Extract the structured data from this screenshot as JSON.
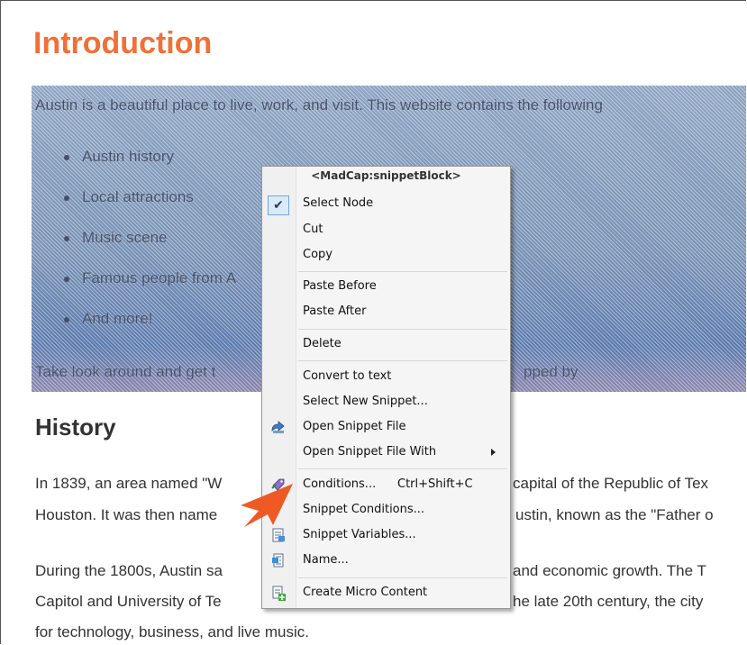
{
  "page": {
    "heading": "Introduction",
    "selected_block": {
      "intro": "Austin is a beautiful place to live, work, and visit. This website contains the following",
      "bullets": [
        "Austin history",
        "Local attractions",
        "Music scene",
        "Famous people from A",
        "And more!"
      ],
      "closing_left": "Take look around and get t",
      "closing_right": "pped by"
    },
    "history_heading": "History",
    "paragraph1": {
      "line1_left": "In 1839, an area named \"W",
      "line1_right": "capital of the Republic of Tex",
      "line2_left": "Houston. It was then name",
      "line2_right": "ustin, known as the \"Father o"
    },
    "paragraph2": {
      "line1_left": "During the 1800s, Austin sa",
      "line1_right": "and economic growth. The T",
      "line2_left": "Capitol and University of Te",
      "line2_right": "he late 20th century, the city",
      "line3": "for technology, business, and live music."
    }
  },
  "context_menu": {
    "header": "<MadCap:snippetBlock>",
    "items": {
      "select_node": "Select Node",
      "cut": "Cut",
      "copy": "Copy",
      "paste_before": "Paste Before",
      "paste_after": "Paste After",
      "delete": "Delete",
      "convert_to_text": "Convert to text",
      "select_new_snippet": "Select New Snippet...",
      "open_snippet_file": "Open Snippet File",
      "open_snippet_file_with": "Open Snippet File With",
      "conditions": "Conditions...",
      "conditions_shortcut": "Ctrl+Shift+C",
      "snippet_conditions": "Snippet Conditions...",
      "snippet_variables": "Snippet Variables...",
      "name": "Name...",
      "create_micro_content": "Create Micro Content"
    },
    "icons": {
      "select_node": "checkmark-icon",
      "open_snippet_file": "open-file-icon",
      "conditions": "conditions-tag-icon",
      "snippet_variables": "variables-icon",
      "name": "name-icon",
      "create_micro_content": "micro-content-icon"
    }
  },
  "colors": {
    "heading": "#f07036",
    "callout_arrow": "#ef5a24"
  }
}
